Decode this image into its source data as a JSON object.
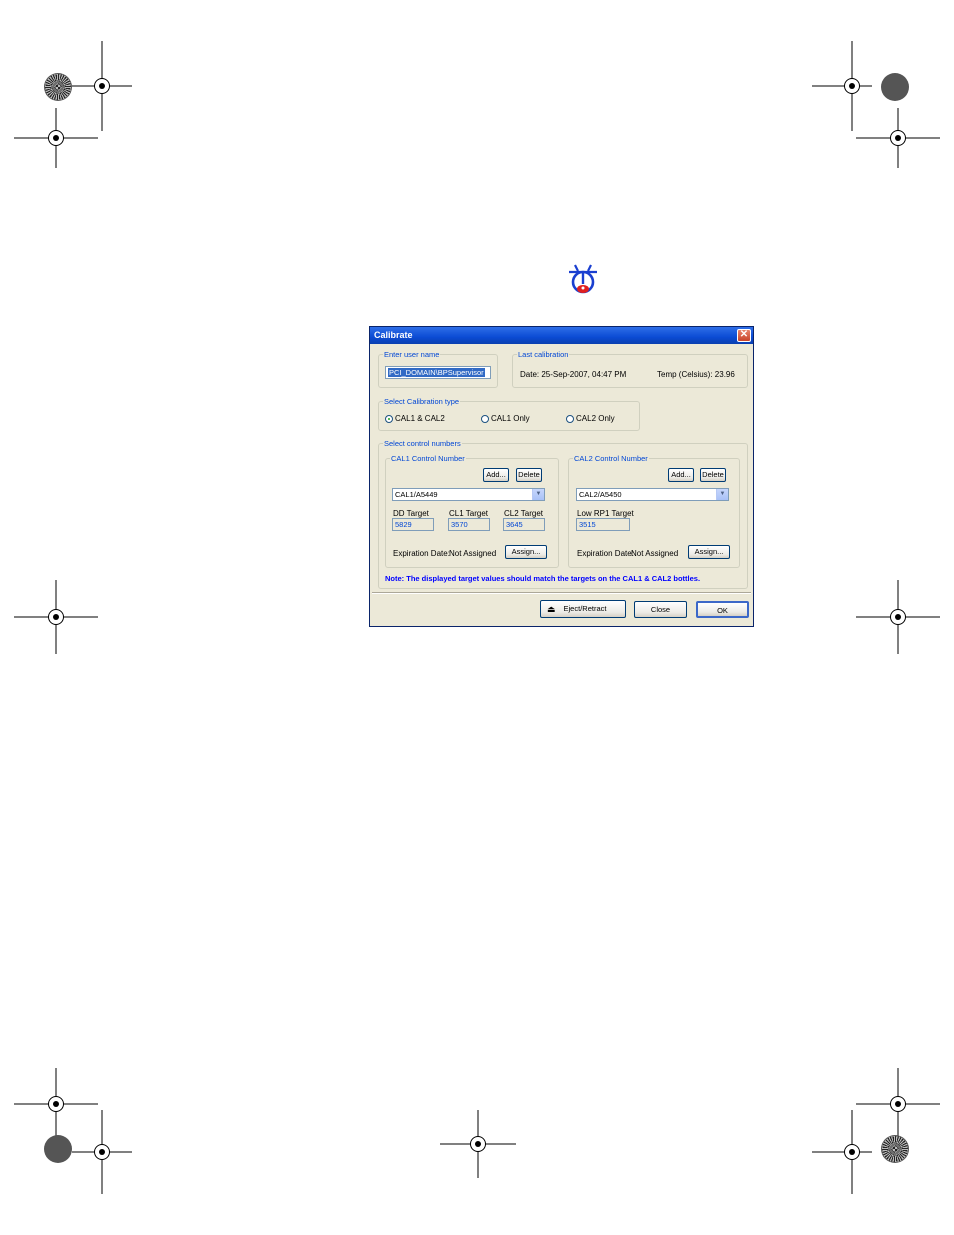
{
  "dialog": {
    "title": "Calibrate",
    "close_glyph": "✕",
    "user": {
      "legend": "Enter user name",
      "value": "PCI_DOMAIN\\BPSupervisor"
    },
    "last_calibration": {
      "legend": "Last calibration",
      "date_text": "Date: 25-Sep-2007, 04:47 PM",
      "temp_text": "Temp (Celsius): 23.96"
    },
    "calibration_type": {
      "legend": "Select Calibration type",
      "options": [
        "CAL1 & CAL2",
        "CAL1 Only",
        "CAL2 Only"
      ],
      "selected_index": 0
    },
    "control_numbers": {
      "legend": "Select control numbers",
      "cal1": {
        "legend": "CAL1 Control Number",
        "add_label": "Add...",
        "delete_label": "Delete",
        "selected": "CAL1/A5449",
        "targets": [
          {
            "label": "DD Target",
            "value": "5829"
          },
          {
            "label": "CL1 Target",
            "value": "3570"
          },
          {
            "label": "CL2 Target",
            "value": "3645"
          }
        ],
        "expiration_label": "Expiration Date:",
        "expiration_value": "Not Assigned",
        "assign_label": "Assign..."
      },
      "cal2": {
        "legend": "CAL2 Control Number",
        "add_label": "Add...",
        "delete_label": "Delete",
        "selected": "CAL2/A5450",
        "targets": [
          {
            "label": "Low RP1 Target",
            "value": "3515"
          }
        ],
        "expiration_label": "Expiration Date:",
        "expiration_value": "Not Assigned",
        "assign_label": "Assign..."
      },
      "note": "Note: The displayed target values should match the targets on the CAL1 & CAL2 bottles."
    },
    "buttons": {
      "eject_label": "Eject/Retract",
      "close_label": "Close",
      "ok_label": "OK"
    }
  },
  "colors": {
    "titlebar": "#0b4bd4",
    "dialog_bg": "#ece9d8",
    "legend_text": "#0046d5",
    "note_text": "#0000ff",
    "icon_red": "#e02020",
    "icon_blue": "#1a3fd0"
  },
  "icons": {
    "calibrate": "calibrate-icon",
    "eject": "eject-icon",
    "close": "close-icon",
    "dropdown": "chevron-down-icon"
  }
}
